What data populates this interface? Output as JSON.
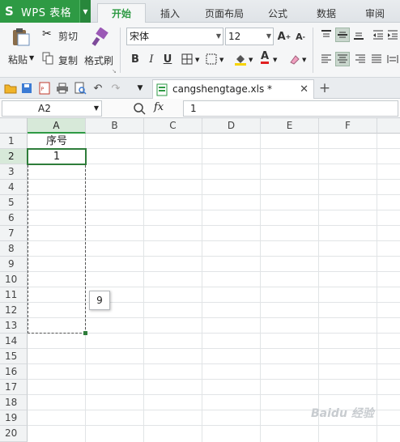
{
  "app": {
    "logo": "S",
    "name": "WPS 表格"
  },
  "menu_tabs": [
    "开始",
    "插入",
    "页面布局",
    "公式",
    "数据",
    "审阅"
  ],
  "ribbon": {
    "paste": "粘贴",
    "cut": "剪切",
    "copy": "复制",
    "format_painter": "格式刷",
    "font_name": "宋体",
    "font_size": "12"
  },
  "document_tab": {
    "filename": "cangshengtage.xls *"
  },
  "formula_bar": {
    "cell_ref": "A2",
    "fx": "fx",
    "value": "1"
  },
  "sheet": {
    "columns": [
      "A",
      "B",
      "C",
      "D",
      "E",
      "F"
    ],
    "rows": [
      "1",
      "2",
      "3",
      "4",
      "5",
      "6",
      "7",
      "8",
      "9",
      "10",
      "11",
      "12",
      "13",
      "14",
      "15",
      "16",
      "17",
      "18",
      "19",
      "20"
    ],
    "cells": {
      "A1": "序号",
      "A2": "1"
    },
    "fill_tooltip": "9"
  },
  "watermark": "Baidu 经验"
}
